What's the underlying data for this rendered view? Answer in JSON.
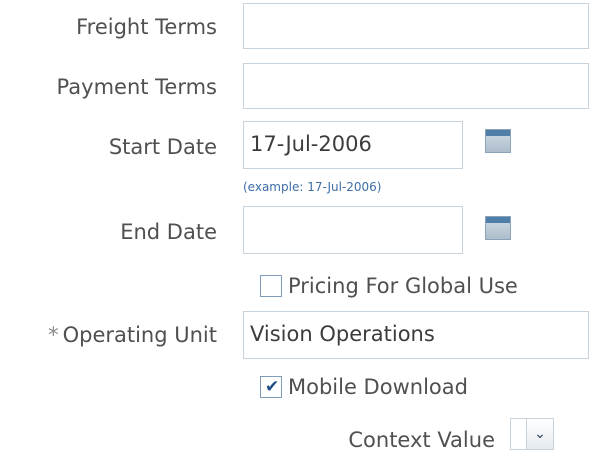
{
  "form": {
    "freight_terms": {
      "label": "Freight Terms",
      "value": ""
    },
    "payment_terms": {
      "label": "Payment Terms",
      "value": ""
    },
    "start_date": {
      "label": "Start Date",
      "value": "17-Jul-2006",
      "hint": "(example: 17-Jul-2006)"
    },
    "end_date": {
      "label": "End Date",
      "value": ""
    },
    "pricing_global": {
      "label": "Pricing For Global Use",
      "checked": false
    },
    "operating_unit": {
      "label": "Operating Unit",
      "required_mark": "*",
      "value": "Vision Operations"
    },
    "mobile_download": {
      "label": "Mobile Download",
      "checked": true,
      "tick": "✔"
    },
    "context_value": {
      "label": "Context Value",
      "value": "",
      "arrow": "⌄"
    }
  },
  "icons": {
    "calendar": "calendar-icon",
    "dropdown": "chevron-down-icon"
  },
  "colors": {
    "label_text": "#505050",
    "field_border": "#c9d3dc",
    "hint_text": "#3d6ea6",
    "calendar_blue": "#4f7fa8"
  }
}
